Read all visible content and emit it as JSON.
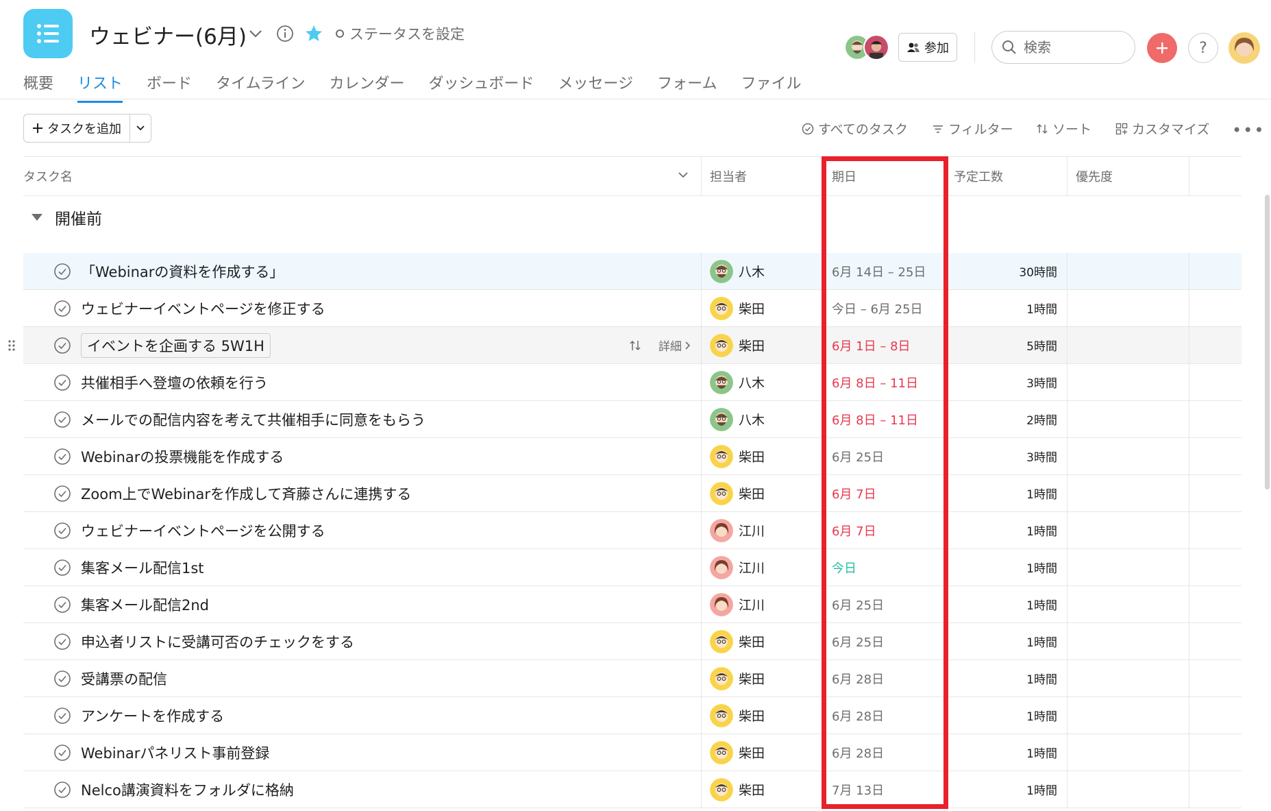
{
  "header": {
    "project_title": "ウェビナー(6月)",
    "status_label": "ステータスを設定",
    "join_label": "参加",
    "search_placeholder": "検索",
    "help_label": "?"
  },
  "tabs": [
    {
      "label": "概要",
      "active": false
    },
    {
      "label": "リスト",
      "active": true
    },
    {
      "label": "ボード",
      "active": false
    },
    {
      "label": "タイムライン",
      "active": false
    },
    {
      "label": "カレンダー",
      "active": false
    },
    {
      "label": "ダッシュボード",
      "active": false
    },
    {
      "label": "メッセージ",
      "active": false
    },
    {
      "label": "フォーム",
      "active": false
    },
    {
      "label": "ファイル",
      "active": false
    }
  ],
  "toolbar": {
    "add_task_label": "タスクを追加",
    "all_tasks_label": "すべてのタスク",
    "filter_label": "フィルター",
    "sort_label": "ソート",
    "customize_label": "カスタマイズ"
  },
  "columns": {
    "name": "タスク名",
    "assignee": "担当者",
    "due": "期日",
    "effort": "予定工数",
    "priority": "優先度"
  },
  "section": {
    "title": "開催前"
  },
  "row_detail_label": "詳細",
  "accent": "#1a8be0",
  "overdue_color": "#e8384f",
  "today_color": "#1fc0a2",
  "highlight_color": "#e8212b",
  "tasks": [
    {
      "name": "「Webinarの資料を作成する」",
      "assignee": "八木",
      "avatar": "green",
      "due": "6月 14日 – 25日",
      "due_state": "normal",
      "effort": "30時間"
    },
    {
      "name": "ウェビナーイベントページを修正する",
      "assignee": "柴田",
      "avatar": "yellow",
      "due": "今日 – 6月 25日",
      "due_state": "normal",
      "effort": "1時間"
    },
    {
      "name": "イベントを企画する 5W1H",
      "assignee": "柴田",
      "avatar": "yellow",
      "due": "6月 1日 – 8日",
      "due_state": "overdue",
      "effort": "5時間"
    },
    {
      "name": "共催相手へ登壇の依頼を行う",
      "assignee": "八木",
      "avatar": "green",
      "due": "6月 8日 – 11日",
      "due_state": "overdue",
      "effort": "3時間"
    },
    {
      "name": "メールでの配信内容を考えて共催相手に同意をもらう",
      "assignee": "八木",
      "avatar": "green",
      "due": "6月 8日 – 11日",
      "due_state": "overdue",
      "effort": "2時間"
    },
    {
      "name": "Webinarの投票機能を作成する",
      "assignee": "柴田",
      "avatar": "yellow",
      "due": "6月 25日",
      "due_state": "normal",
      "effort": "3時間"
    },
    {
      "name": "Zoom上でWebinarを作成して斉藤さんに連携する",
      "assignee": "柴田",
      "avatar": "yellow",
      "due": "6月 7日",
      "due_state": "overdue",
      "effort": "1時間"
    },
    {
      "name": "ウェビナーイベントページを公開する",
      "assignee": "江川",
      "avatar": "pink",
      "due": "6月 7日",
      "due_state": "overdue",
      "effort": "1時間"
    },
    {
      "name": "集客メール配信1st",
      "assignee": "江川",
      "avatar": "pink",
      "due": "今日",
      "due_state": "today",
      "effort": "1時間"
    },
    {
      "name": "集客メール配信2nd",
      "assignee": "江川",
      "avatar": "pink",
      "due": "6月 25日",
      "due_state": "normal",
      "effort": "1時間"
    },
    {
      "name": "申込者リストに受講可否のチェックをする",
      "assignee": "柴田",
      "avatar": "yellow",
      "due": "6月 25日",
      "due_state": "normal",
      "effort": "1時間"
    },
    {
      "name": "受講票の配信",
      "assignee": "柴田",
      "avatar": "yellow",
      "due": "6月 28日",
      "due_state": "normal",
      "effort": "1時間"
    },
    {
      "name": "アンケートを作成する",
      "assignee": "柴田",
      "avatar": "yellow",
      "due": "6月 28日",
      "due_state": "normal",
      "effort": "1時間"
    },
    {
      "name": "Webinarパネリスト事前登録",
      "assignee": "柴田",
      "avatar": "yellow",
      "due": "6月 28日",
      "due_state": "normal",
      "effort": "1時間"
    },
    {
      "name": "Nelco講演資料をフォルダに格納",
      "assignee": "柴田",
      "avatar": "yellow",
      "due": "7月 13日",
      "due_state": "normal",
      "effort": "1時間"
    }
  ]
}
